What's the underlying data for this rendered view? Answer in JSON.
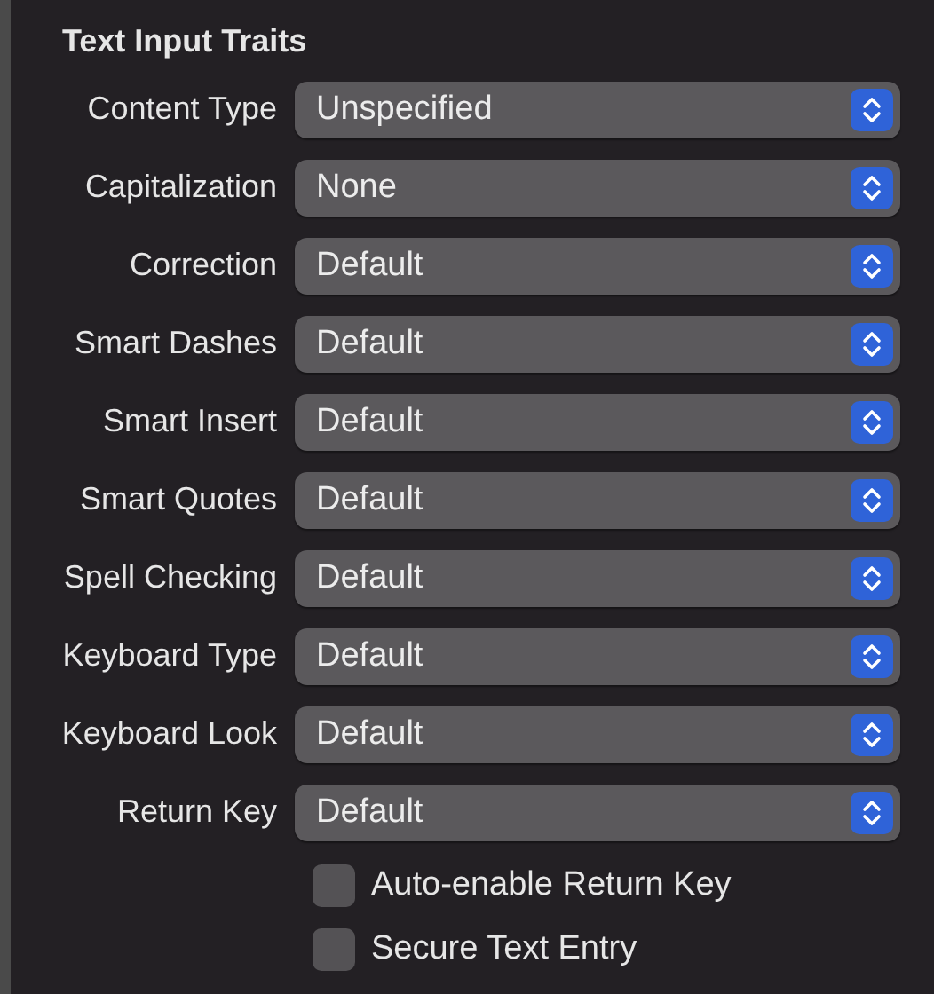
{
  "section": {
    "title": "Text Input Traits"
  },
  "fields": [
    {
      "label": "Content Type",
      "value": "Unspecified"
    },
    {
      "label": "Capitalization",
      "value": "None"
    },
    {
      "label": "Correction",
      "value": "Default"
    },
    {
      "label": "Smart Dashes",
      "value": "Default"
    },
    {
      "label": "Smart Insert",
      "value": "Default"
    },
    {
      "label": "Smart Quotes",
      "value": "Default"
    },
    {
      "label": "Spell Checking",
      "value": "Default"
    },
    {
      "label": "Keyboard Type",
      "value": "Default"
    },
    {
      "label": "Keyboard Look",
      "value": "Default"
    },
    {
      "label": "Return Key",
      "value": "Default"
    }
  ],
  "checkboxes": [
    {
      "label": "Auto-enable Return Key",
      "checked": false
    },
    {
      "label": "Secure Text Entry",
      "checked": false
    }
  ]
}
